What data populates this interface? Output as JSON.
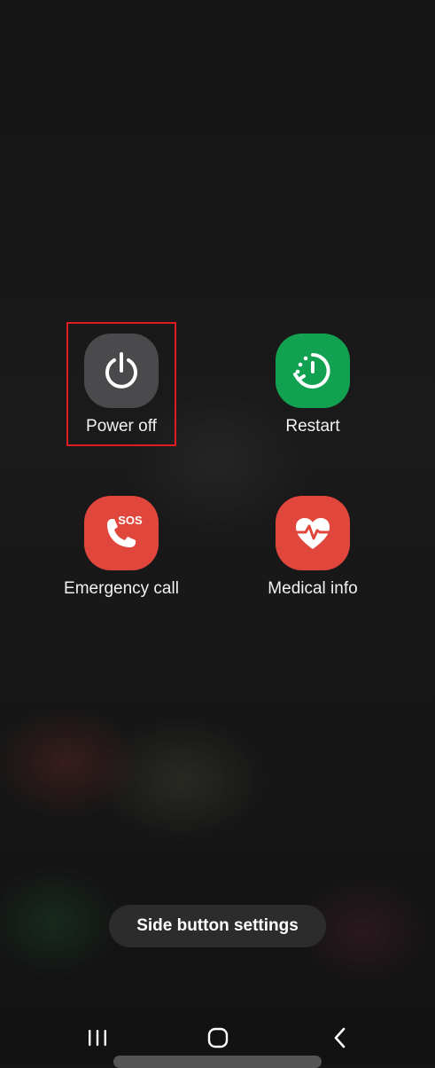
{
  "power_menu": {
    "items": [
      {
        "id": "power_off",
        "label": "Power off",
        "icon": "power-icon",
        "color": "#4a4a4d"
      },
      {
        "id": "restart",
        "label": "Restart",
        "icon": "restart-icon",
        "color": "#12a150"
      },
      {
        "id": "emergency_call",
        "label": "Emergency call",
        "icon": "sos-phone-icon",
        "icon_text": "SOS",
        "color": "#e0463b"
      },
      {
        "id": "medical_info",
        "label": "Medical info",
        "icon": "heart-pulse-icon",
        "color": "#e0463b"
      }
    ],
    "highlighted_item": "power_off",
    "highlight_color": "#e01b24"
  },
  "side_button": {
    "label": "Side button settings"
  },
  "navigation": {
    "buttons": [
      "recent-apps-icon",
      "home-icon",
      "back-icon"
    ]
  }
}
